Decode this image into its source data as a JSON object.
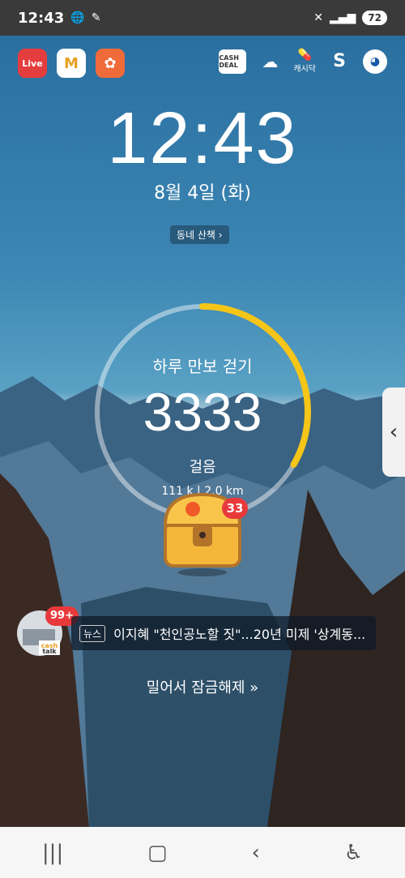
{
  "status": {
    "time": "12:43",
    "battery": "72"
  },
  "apps": [
    {
      "name": "Live",
      "color": "#e43d3d"
    },
    {
      "name": "M",
      "color": "#ffffff"
    },
    {
      "name": "paw",
      "color": "#f06b3a"
    }
  ],
  "quick": {
    "cashdeal": "CASH DEAL",
    "cashidak": "캐시닥"
  },
  "lockscreen": {
    "time": "12:43",
    "date": "8월 4일 (화)",
    "walk_chip": "동네 산책 ›"
  },
  "pedometer": {
    "title": "하루 만보 걷기",
    "steps": "3333",
    "unit": "걸음",
    "kcal": "111 k",
    "distance": "2.0 km",
    "progress": 0.3333
  },
  "chest_badge": "33",
  "news": {
    "badge": "99+",
    "tag": "뉴스",
    "headline": "이지혜 \"천인공노할 짓\"...20년 미제 '상계동..."
  },
  "unlock_text": "밀어서 잠금해제 »",
  "colors": {
    "accent": "#f5c518",
    "badge": "#e8393b"
  }
}
